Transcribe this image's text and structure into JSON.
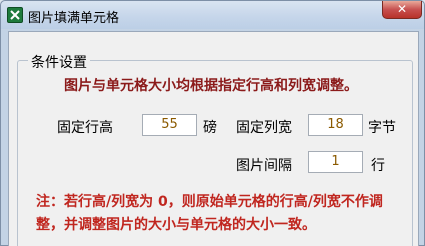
{
  "window": {
    "title": "图片填满单元格",
    "close_glyph": "✕"
  },
  "group": {
    "title": "条件设置"
  },
  "instruction": "图片与单元格大小均根据指定行高和列宽调整。",
  "row_height": {
    "label": "固定行高",
    "value": "55",
    "unit": "磅"
  },
  "col_width": {
    "label": "固定列宽",
    "value": "18",
    "unit": "字节"
  },
  "spacing": {
    "label": "图片间隔",
    "value": "1",
    "unit": "行"
  },
  "note": "注：若行高/列宽为 0，则原始单元格的行高/列宽不作调整，并调整图片的大小与单元格的大小一致。"
}
